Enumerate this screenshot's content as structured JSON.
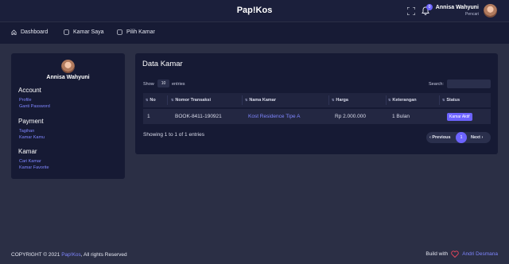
{
  "app": {
    "brand": "Pap!Kos"
  },
  "topbar": {
    "notification_count": "0",
    "user_name": "Annisa Wahyuni",
    "user_role": "Pencari"
  },
  "nav": {
    "items": [
      {
        "label": "Dashboard",
        "icon": "home-icon"
      },
      {
        "label": "Kamar Saya",
        "icon": "square-icon"
      },
      {
        "label": "Pilih Kamar",
        "icon": "square-icon"
      }
    ]
  },
  "sidebar": {
    "name": "Annisa Wahyuni",
    "sections": [
      {
        "title": "Account",
        "links": [
          "Profile",
          "Ganti Password"
        ]
      },
      {
        "title": "Payment",
        "links": [
          "Tagihan",
          "Kamar Kamu"
        ]
      },
      {
        "title": "Kamar",
        "links": [
          "Cari Kamar",
          "Kamar Favorite"
        ]
      }
    ]
  },
  "main": {
    "title": "Data Kamar",
    "show_label": "Show",
    "show_value": "10",
    "entries_label": "entries",
    "search_label": "Search:",
    "search_value": "",
    "columns": [
      "No",
      "Nomor Transaksi",
      "Nama Kamar",
      "Harga",
      "Keterangan",
      "Status"
    ],
    "rows": [
      {
        "no": "1",
        "nomor_transaksi": "BOOK-8411-190921",
        "nama_kamar": "Kost Residence Tipe A",
        "harga": "Rp 2.000.000",
        "keterangan": "1 Bulan",
        "status": "Kamar Aktif"
      }
    ],
    "info": "Showing 1 to 1 of 1 entries",
    "pager": {
      "previous": "‹ Previous",
      "current": "1",
      "next": "Next ›"
    }
  },
  "footer": {
    "copyright_prefix": "COPYRIGHT © 2021",
    "copyright_brand": "Pap!Kos",
    "copyright_suffix": ", All rights Reserved",
    "built_with": "Build with",
    "author": "Andri Desmana"
  },
  "colors": {
    "accent": "#6c63ff",
    "link": "#7f86ff",
    "background": "#2b2f45",
    "card": "#161a34",
    "heart": "#e0455a"
  }
}
